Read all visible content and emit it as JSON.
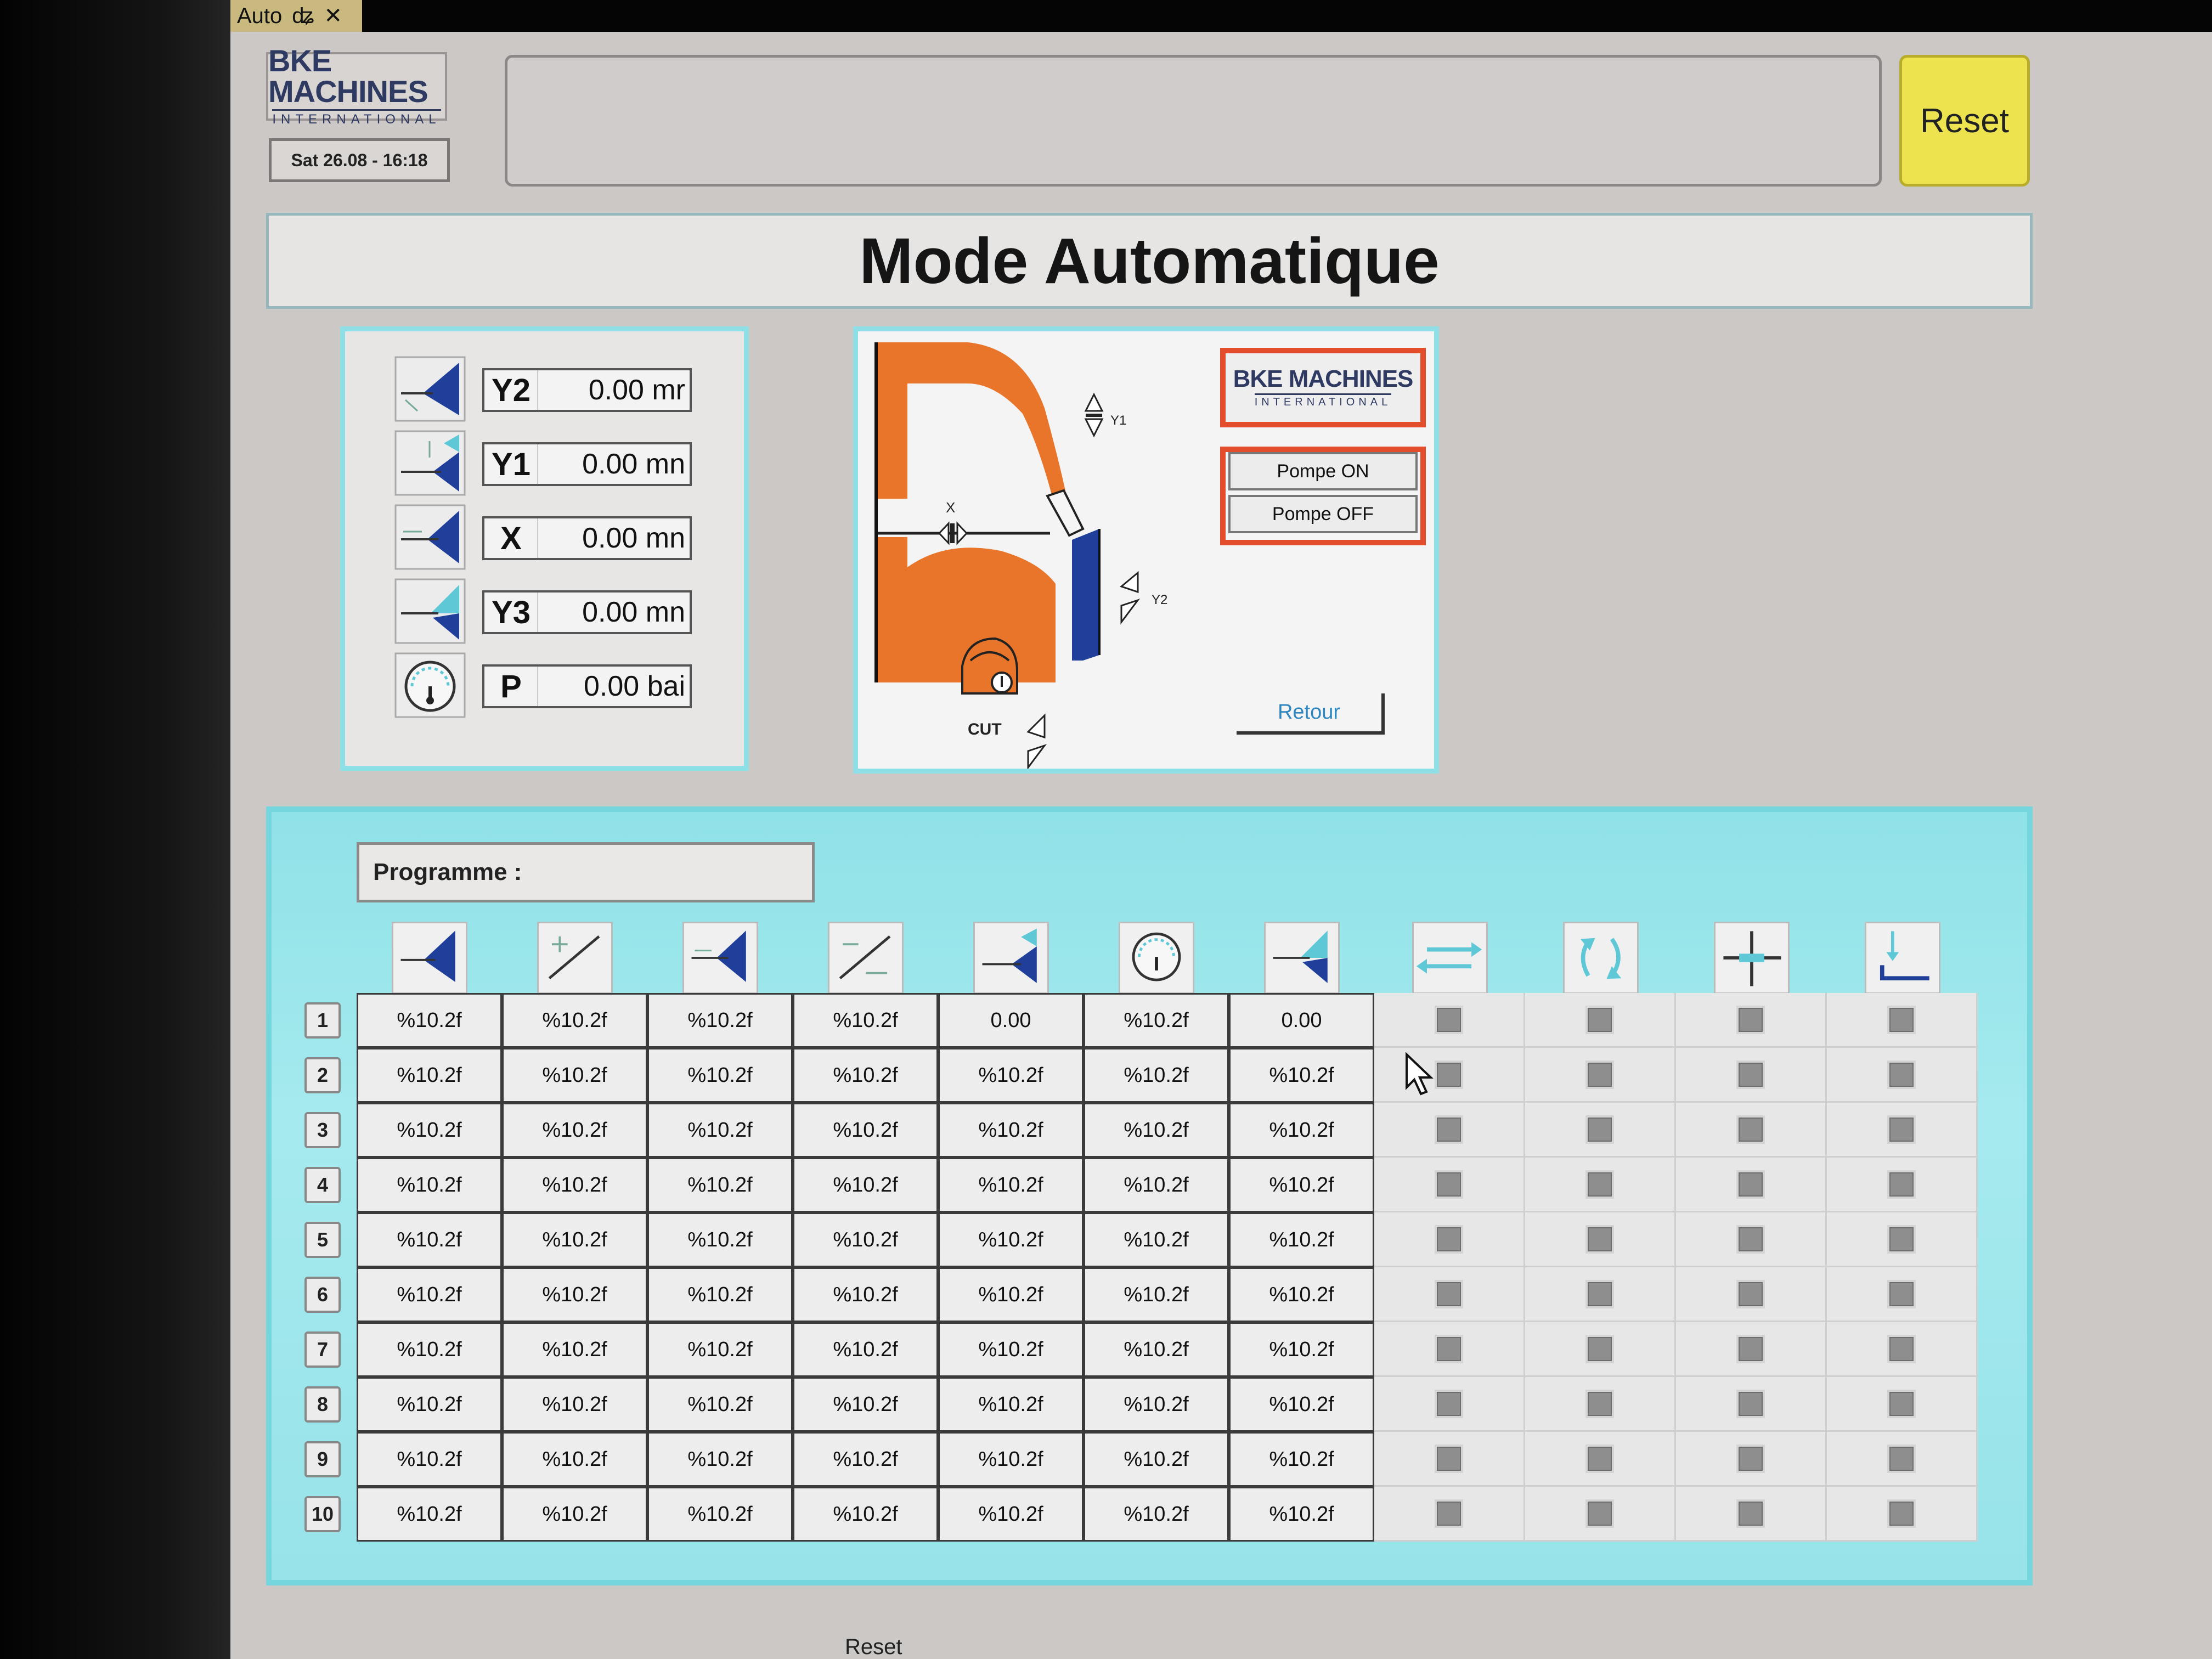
{
  "window": {
    "tab_label": "Auto",
    "pin_icon": "pin-icon",
    "close_icon": "close-icon"
  },
  "header": {
    "logo_main": "BKE MACHINES",
    "logo_sub": "INTERNATIONAL",
    "datetime": "Sat 26.08 - 16:18",
    "message": "",
    "reset_label": "Reset"
  },
  "title": "Mode Automatique",
  "axes": [
    {
      "label": "Y2",
      "value": "0.00 mr",
      "icon": "axis-y2-icon"
    },
    {
      "label": "Y1",
      "value": "0.00 mn",
      "icon": "axis-y1-icon"
    },
    {
      "label": "X",
      "value": "0.00 mn",
      "icon": "axis-x-icon"
    },
    {
      "label": "Y3",
      "value": "0.00 mn",
      "icon": "axis-y3-icon"
    },
    {
      "label": "P",
      "value": "0.00 bai",
      "icon": "pressure-gauge-icon"
    }
  ],
  "diagram": {
    "label_x": "X",
    "label_y1": "Y1",
    "label_y2": "Y2",
    "label_cut": "CUT",
    "logo_main": "BKE MACHINES",
    "logo_sub": "INTERNATIONAL",
    "pump_on": "Pompe ON",
    "pump_off": "Pompe OFF",
    "retour": "Retour"
  },
  "program": {
    "label": "Programme :",
    "header_icons": [
      "axis-y2-icon",
      "angle-plus-icon",
      "axis-x-icon",
      "angle-minus-icon",
      "axis-y1-icon",
      "pressure-gauge-icon",
      "axis-y3-icon",
      "swap-icon",
      "rotate-icon",
      "cross-icon",
      "down-stop-icon"
    ],
    "rows": [
      {
        "num": "1",
        "values": [
          "%10.2f",
          "%10.2f",
          "%10.2f",
          "%10.2f",
          "0.00",
          "%10.2f",
          "0.00"
        ]
      },
      {
        "num": "2",
        "values": [
          "%10.2f",
          "%10.2f",
          "%10.2f",
          "%10.2f",
          "%10.2f",
          "%10.2f",
          "%10.2f"
        ]
      },
      {
        "num": "3",
        "values": [
          "%10.2f",
          "%10.2f",
          "%10.2f",
          "%10.2f",
          "%10.2f",
          "%10.2f",
          "%10.2f"
        ]
      },
      {
        "num": "4",
        "values": [
          "%10.2f",
          "%10.2f",
          "%10.2f",
          "%10.2f",
          "%10.2f",
          "%10.2f",
          "%10.2f"
        ]
      },
      {
        "num": "5",
        "values": [
          "%10.2f",
          "%10.2f",
          "%10.2f",
          "%10.2f",
          "%10.2f",
          "%10.2f",
          "%10.2f"
        ]
      },
      {
        "num": "6",
        "values": [
          "%10.2f",
          "%10.2f",
          "%10.2f",
          "%10.2f",
          "%10.2f",
          "%10.2f",
          "%10.2f"
        ]
      },
      {
        "num": "7",
        "values": [
          "%10.2f",
          "%10.2f",
          "%10.2f",
          "%10.2f",
          "%10.2f",
          "%10.2f",
          "%10.2f"
        ]
      },
      {
        "num": "8",
        "values": [
          "%10.2f",
          "%10.2f",
          "%10.2f",
          "%10.2f",
          "%10.2f",
          "%10.2f",
          "%10.2f"
        ]
      },
      {
        "num": "9",
        "values": [
          "%10.2f",
          "%10.2f",
          "%10.2f",
          "%10.2f",
          "%10.2f",
          "%10.2f",
          "%10.2f"
        ]
      },
      {
        "num": "10",
        "values": [
          "%10.2f",
          "%10.2f",
          "%10.2f",
          "%10.2f",
          "%10.2f",
          "%10.2f",
          "%10.2f"
        ]
      }
    ],
    "checkbox_columns": 4
  },
  "footer": {
    "partial_label": "Reset"
  },
  "colors": {
    "accent_cyan": "#8fe0e6",
    "reset_yellow": "#ece34f",
    "machine_orange": "#e8752a",
    "logo_red": "#e44d2b",
    "icon_blue": "#1f3f9a"
  }
}
